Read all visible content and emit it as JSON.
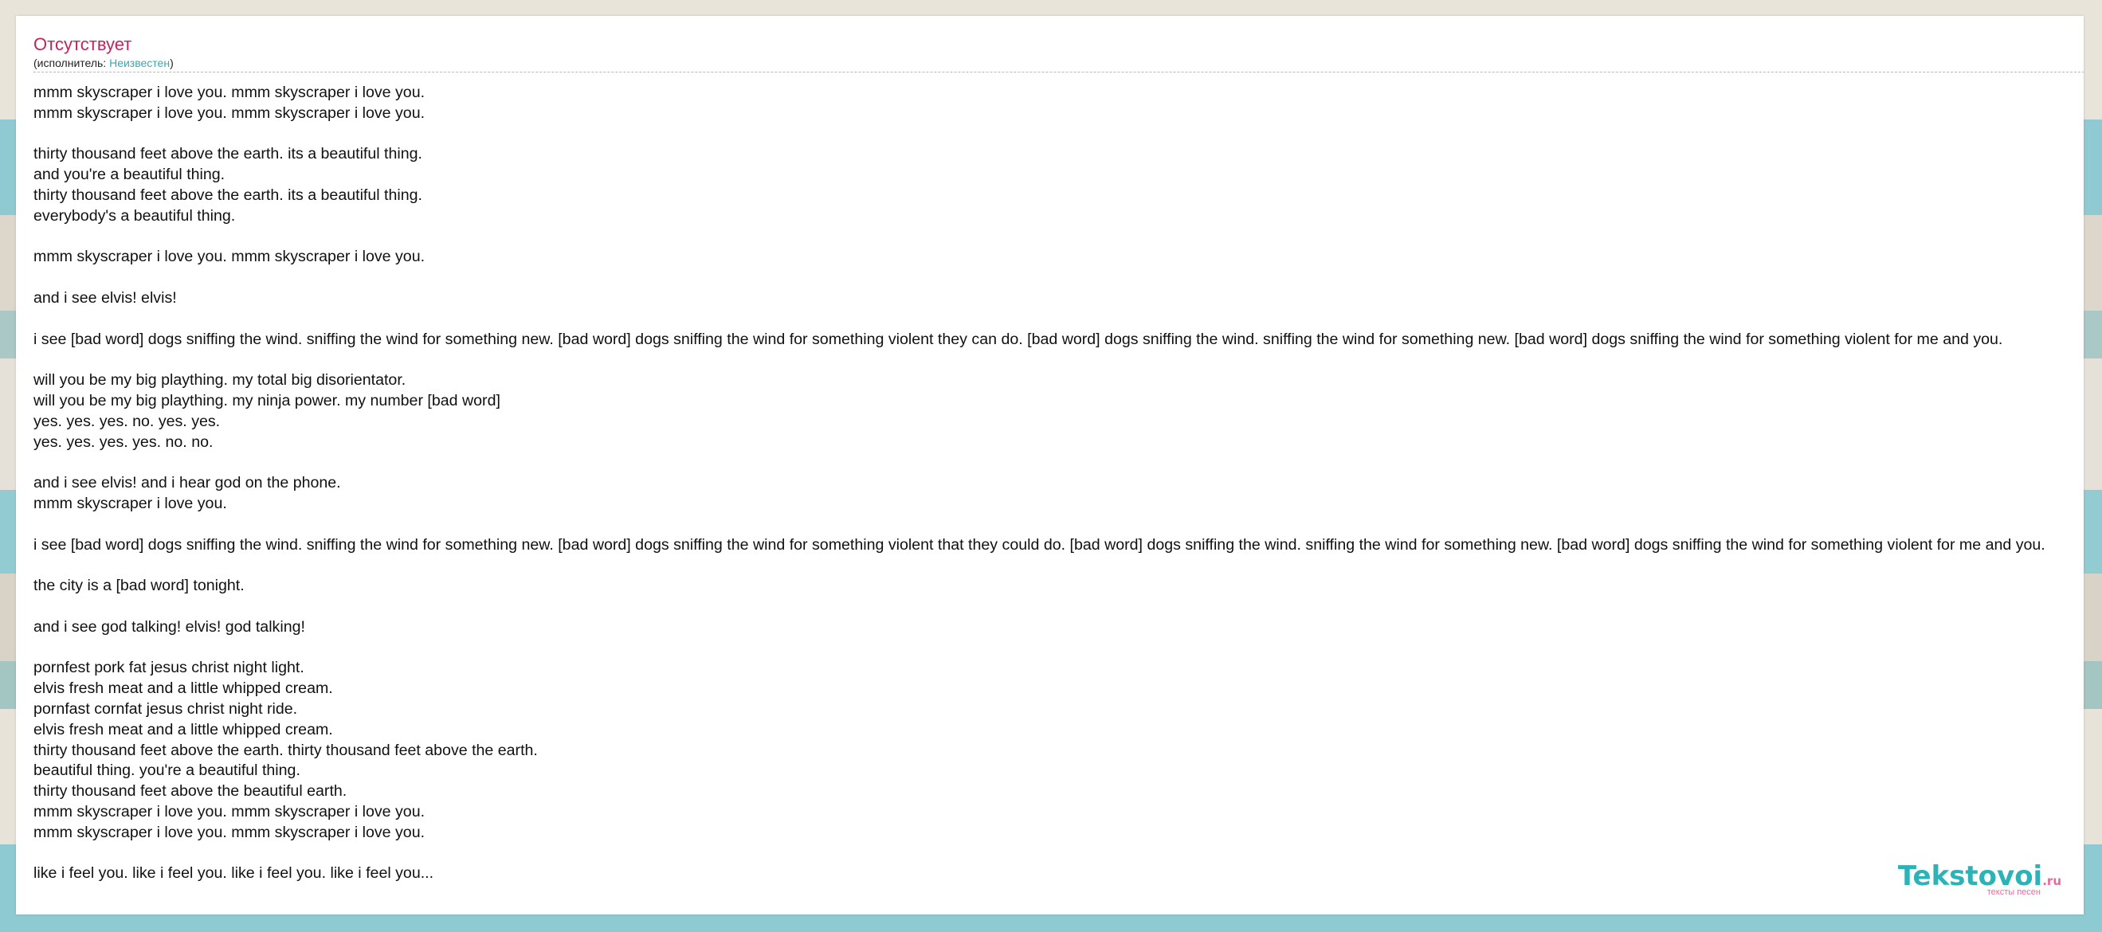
{
  "song": {
    "title": "Отсутствует",
    "artist_prefix": "(исполнитель: ",
    "artist_name": "Неизвестен",
    "artist_suffix": ")"
  },
  "lyrics": [
    "mmm skyscraper i love you. mmm skyscraper i love you.",
    "mmm skyscraper i love you. mmm skyscraper i love you.",
    "",
    "thirty thousand feet above the earth. its a beautiful thing.",
    "and you're a beautiful thing.",
    "thirty thousand feet above the earth. its a beautiful thing.",
    "everybody's a beautiful thing.",
    "",
    "mmm skyscraper i love you. mmm skyscraper i love you.",
    "",
    "and i see elvis! elvis!",
    "",
    "i see [bad word] dogs sniffing the wind. sniffing the wind for something new. [bad word] dogs sniffing the wind for something violent they can do. [bad word] dogs sniffing the wind. sniffing the wind for something new. [bad word] dogs sniffing the wind for something violent for me and you.",
    "",
    "will you be my big plaything. my total big disorientator.",
    "will you be my big plaything. my ninja power. my number [bad word]",
    "yes. yes. yes. no. yes. yes.",
    "yes. yes. yes. yes. no. no.",
    "",
    "and i see elvis! and i hear god on the phone.",
    "mmm skyscraper i love you.",
    "",
    "i see [bad word] dogs sniffing the wind. sniffing the wind for something new. [bad word] dogs sniffing the wind for something violent that they could do. [bad word] dogs sniffing the wind. sniffing the wind for something new. [bad word] dogs sniffing the wind for something violent for me and you.",
    "",
    "the city is a [bad word] tonight.",
    "",
    "and i see god talking! elvis! god talking!",
    "",
    "pornfest pork fat jesus christ night light.",
    "elvis fresh meat and a little whipped cream.",
    "pornfast cornfat jesus christ night ride.",
    "elvis fresh meat and a little whipped cream.",
    "thirty thousand feet above the earth. thirty thousand feet above the earth.",
    "beautiful thing. you're a beautiful thing.",
    "thirty thousand feet above the beautiful earth.",
    "mmm skyscraper i love you. mmm skyscraper i love you.",
    "mmm skyscraper i love you. mmm skyscraper i love you.",
    "",
    "like i feel you. like i feel you. like i feel you. like i feel you..."
  ],
  "logo": {
    "main": "Tekstovoi",
    "tld": ".ru",
    "tagline": "тексты песен"
  },
  "colors": {
    "title": "#c4245b",
    "link": "#3ba6b4",
    "logo_main": "#2bb3b8",
    "logo_accent": "#e86a9a"
  }
}
